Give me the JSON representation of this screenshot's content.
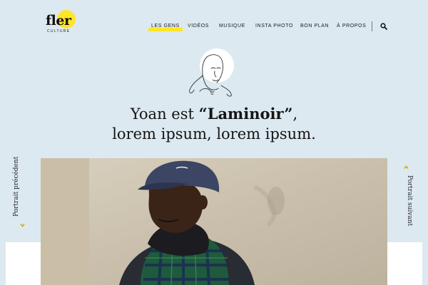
{
  "brand": {
    "name": "fler",
    "tagline": "CULTURE",
    "accent_color": "#fde52a"
  },
  "nav": {
    "items": [
      {
        "label": "LES GENS",
        "active": true
      },
      {
        "label": "VIDÉOS",
        "active": false
      },
      {
        "label": "MUSIQUE",
        "active": false
      },
      {
        "label": "INSTA PHOTO",
        "active": false
      },
      {
        "label": "BON PLAN",
        "active": false
      },
      {
        "label": "À PROPOS",
        "active": false
      }
    ],
    "search_icon": "search-icon"
  },
  "article": {
    "headline_pre": "Yoan est ",
    "headline_strong": "“Laminoir”",
    "headline_post": ",",
    "headline_line2": "lorem ipsum, lorem ipsum."
  },
  "portrait_nav": {
    "prev_label": "Portrait précédent",
    "next_label": "Portrait suivant"
  },
  "colors": {
    "background": "#dde9f0",
    "text": "#111111"
  }
}
